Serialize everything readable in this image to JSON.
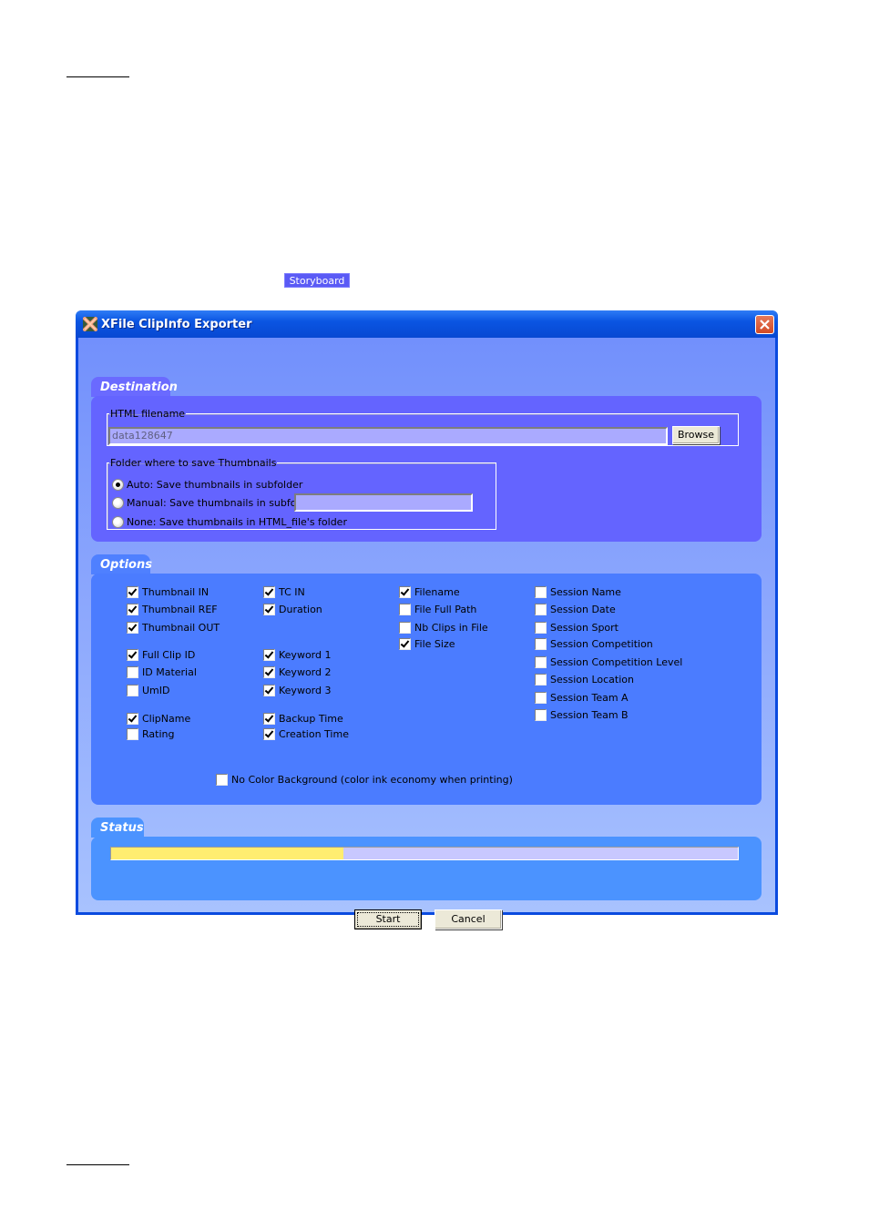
{
  "page": {
    "highlight_tag": "Storyboard"
  },
  "window": {
    "title": "XFile ClipInfo Exporter",
    "icon": "xfile-app-icon",
    "close_icon": "close-icon"
  },
  "destination": {
    "tab_label": "Destination",
    "html_filename": {
      "legend": "HTML filename",
      "value": "data128647",
      "browse_label": "Browse"
    },
    "thumbnail_folder": {
      "legend": "Folder where to save Thumbnails",
      "options": [
        {
          "label": "Auto: Save thumbnails in subfolder",
          "selected": true
        },
        {
          "label": "Manual: Save thumbnails in subfolder",
          "selected": false
        },
        {
          "label": "None: Save thumbnails in HTML_file's folder",
          "selected": false
        }
      ],
      "manual_subfolder_value": ""
    }
  },
  "options": {
    "tab_label": "Options",
    "columns": [
      [
        {
          "label": "Thumbnail IN",
          "checked": true
        },
        {
          "label": "Thumbnail REF",
          "checked": true
        },
        {
          "label": "Thumbnail OUT",
          "checked": true
        },
        {
          "label": "Full Clip ID",
          "checked": true
        },
        {
          "label": "ID Material",
          "checked": false
        },
        {
          "label": "UmID",
          "checked": false
        },
        {
          "label": "ClipName",
          "checked": true
        },
        {
          "label": "Rating",
          "checked": false
        }
      ],
      [
        {
          "label": "TC IN",
          "checked": true
        },
        {
          "label": "Duration",
          "checked": true
        },
        {
          "label": "Keyword 1",
          "checked": true
        },
        {
          "label": "Keyword 2",
          "checked": true
        },
        {
          "label": "Keyword 3",
          "checked": true
        },
        {
          "label": "Backup Time",
          "checked": true
        },
        {
          "label": "Creation Time",
          "checked": true
        }
      ],
      [
        {
          "label": "Filename",
          "checked": true
        },
        {
          "label": "File Full Path",
          "checked": false
        },
        {
          "label": "Nb Clips in File",
          "checked": false
        },
        {
          "label": "File Size",
          "checked": true
        }
      ],
      [
        {
          "label": "Session Name",
          "checked": false
        },
        {
          "label": "Session Date",
          "checked": false
        },
        {
          "label": "Session Sport",
          "checked": false
        },
        {
          "label": "Session Competition",
          "checked": false
        },
        {
          "label": "Session Competition Level",
          "checked": false
        },
        {
          "label": "Session Location",
          "checked": false
        },
        {
          "label": "Session Team A",
          "checked": false
        },
        {
          "label": "Session Team B",
          "checked": false
        }
      ]
    ],
    "no_color_background": {
      "label": "No Color Background (color ink economy when printing)",
      "checked": false
    }
  },
  "status": {
    "tab_label": "Status",
    "progress_percent": 37
  },
  "buttons": {
    "start_label": "Start",
    "cancel_label": "Cancel"
  }
}
